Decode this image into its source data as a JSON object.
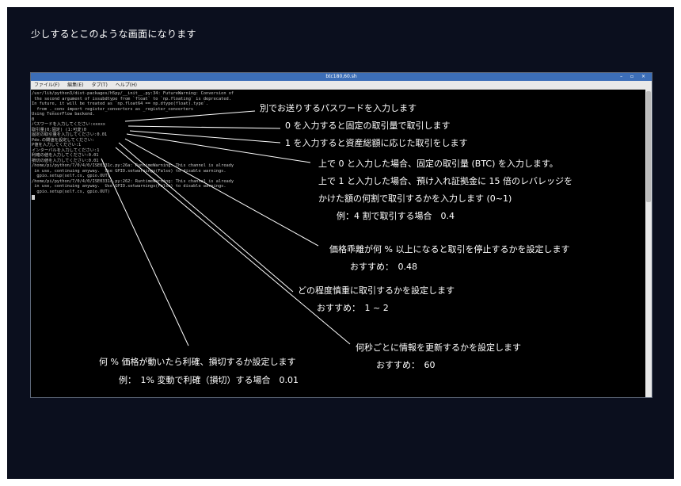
{
  "slide": {
    "heading": "少しするとこのような画面になります"
  },
  "window": {
    "title": "btc180,60.sh",
    "controls": "– ▫ ×",
    "menu": [
      "ファイル(F)",
      "編集(E)",
      "タブ(T)",
      "ヘルプ(H)"
    ]
  },
  "terminal": {
    "lines": [
      "/usr/lib/python3/dist-packages/h5py/__init__.py:34: FutureWarning: Conversion of",
      " the second argument of issubdtype from `float` to `np.floating` is deprecated.",
      "In future, it will be treated as `np.float64 == np.dtype(float).type`.",
      "  from ._conv import register_converters as _register_converters",
      "Using TensorFlow backend.",
      "0",
      "パスワードを入力してください:xxxxx",
      "取引量(0:固定) (1:可変)0",
      "固定の取引量を入力してください:0.01",
      "Pdo.の閾値を設定してください:",
      "P値を入力してください:1",
      "インターバルを入力してください:1",
      "利確の値を入力してください:0.01",
      "損切の値を入力してください:0.01",
      "/home/pi/python/7/0/4/0/ISE0331c.py:26a: RuntimeWarning: This channel is already",
      " in use, continuing anyway.  Use GPIO.setwarnings(False) to disable warnings.",
      "  gpio.setup(self.cs, gpio.OUT)",
      "/home/pi/python/7/0/4/0/ISE0331c.py:262: RuntimeWarning: This channel is already",
      " in use, continuing anyway.  Use GPIO.setwarnings(False) to disable warnings.",
      "  gpio.setup(self.cs, gpio.OUT)"
    ]
  },
  "callouts": {
    "password": "別でお送りするパスワードを入力します",
    "fixed": "0 を入力すると固定の取引量で取引します",
    "variable": "1 を入力すると資産総額に応じた取引をします",
    "btc1": "上で 0 と入力した場合、固定の取引量 (BTC) を入力します。",
    "btc2": "上で 1 と入力した場合、預け入れ証拠金に 15 倍のレバレッジを",
    "btc3": "かけた額の何割で取引するかを入力します (0~1)",
    "btc4": "例：4 割で取引する場合　0.4",
    "dev1": "価格乖離が何 % 以上になると取引を停止するかを設定します",
    "dev2": "おすすめ：　0.48",
    "care1": "どの程度慎重に取引するかを設定します",
    "care2": "おすすめ：　1 ~ 2",
    "int1": "何秒ごとに情報を更新するかを設定します",
    "int2": "おすすめ：　60",
    "tp1": "何 % 価格が動いたら利確、損切するか設定します",
    "tp2": "例：　1% 変動で利確（損切）する場合　0.01"
  }
}
